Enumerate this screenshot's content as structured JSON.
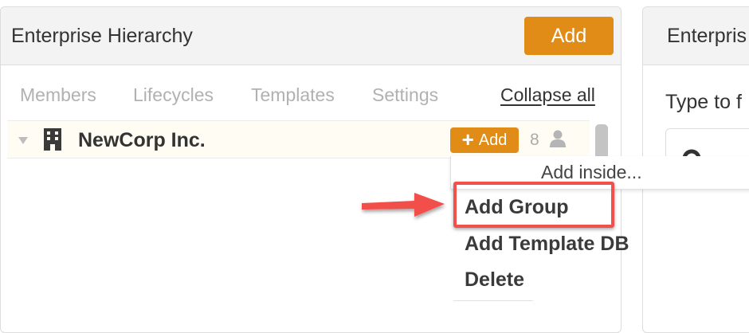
{
  "left_panel": {
    "title": "Enterprise Hierarchy",
    "add_button": "Add",
    "tabs": [
      "Members",
      "Lifecycles",
      "Templates",
      "Settings"
    ],
    "collapse_all": "Collapse all",
    "tree": {
      "node_name": "NewCorp Inc.",
      "node_icon": "building-icon",
      "add_button": "Add",
      "member_count": "8"
    }
  },
  "right_panel": {
    "title": "Enterpris",
    "search_label": "Type to f"
  },
  "dropdown": {
    "header": "Add inside...",
    "items": [
      "Add Group",
      "Add Template DB",
      "Delete"
    ],
    "highlighted_item": "Add Group"
  },
  "colors": {
    "accent": "#e08c16",
    "highlight": "#f2504b"
  }
}
